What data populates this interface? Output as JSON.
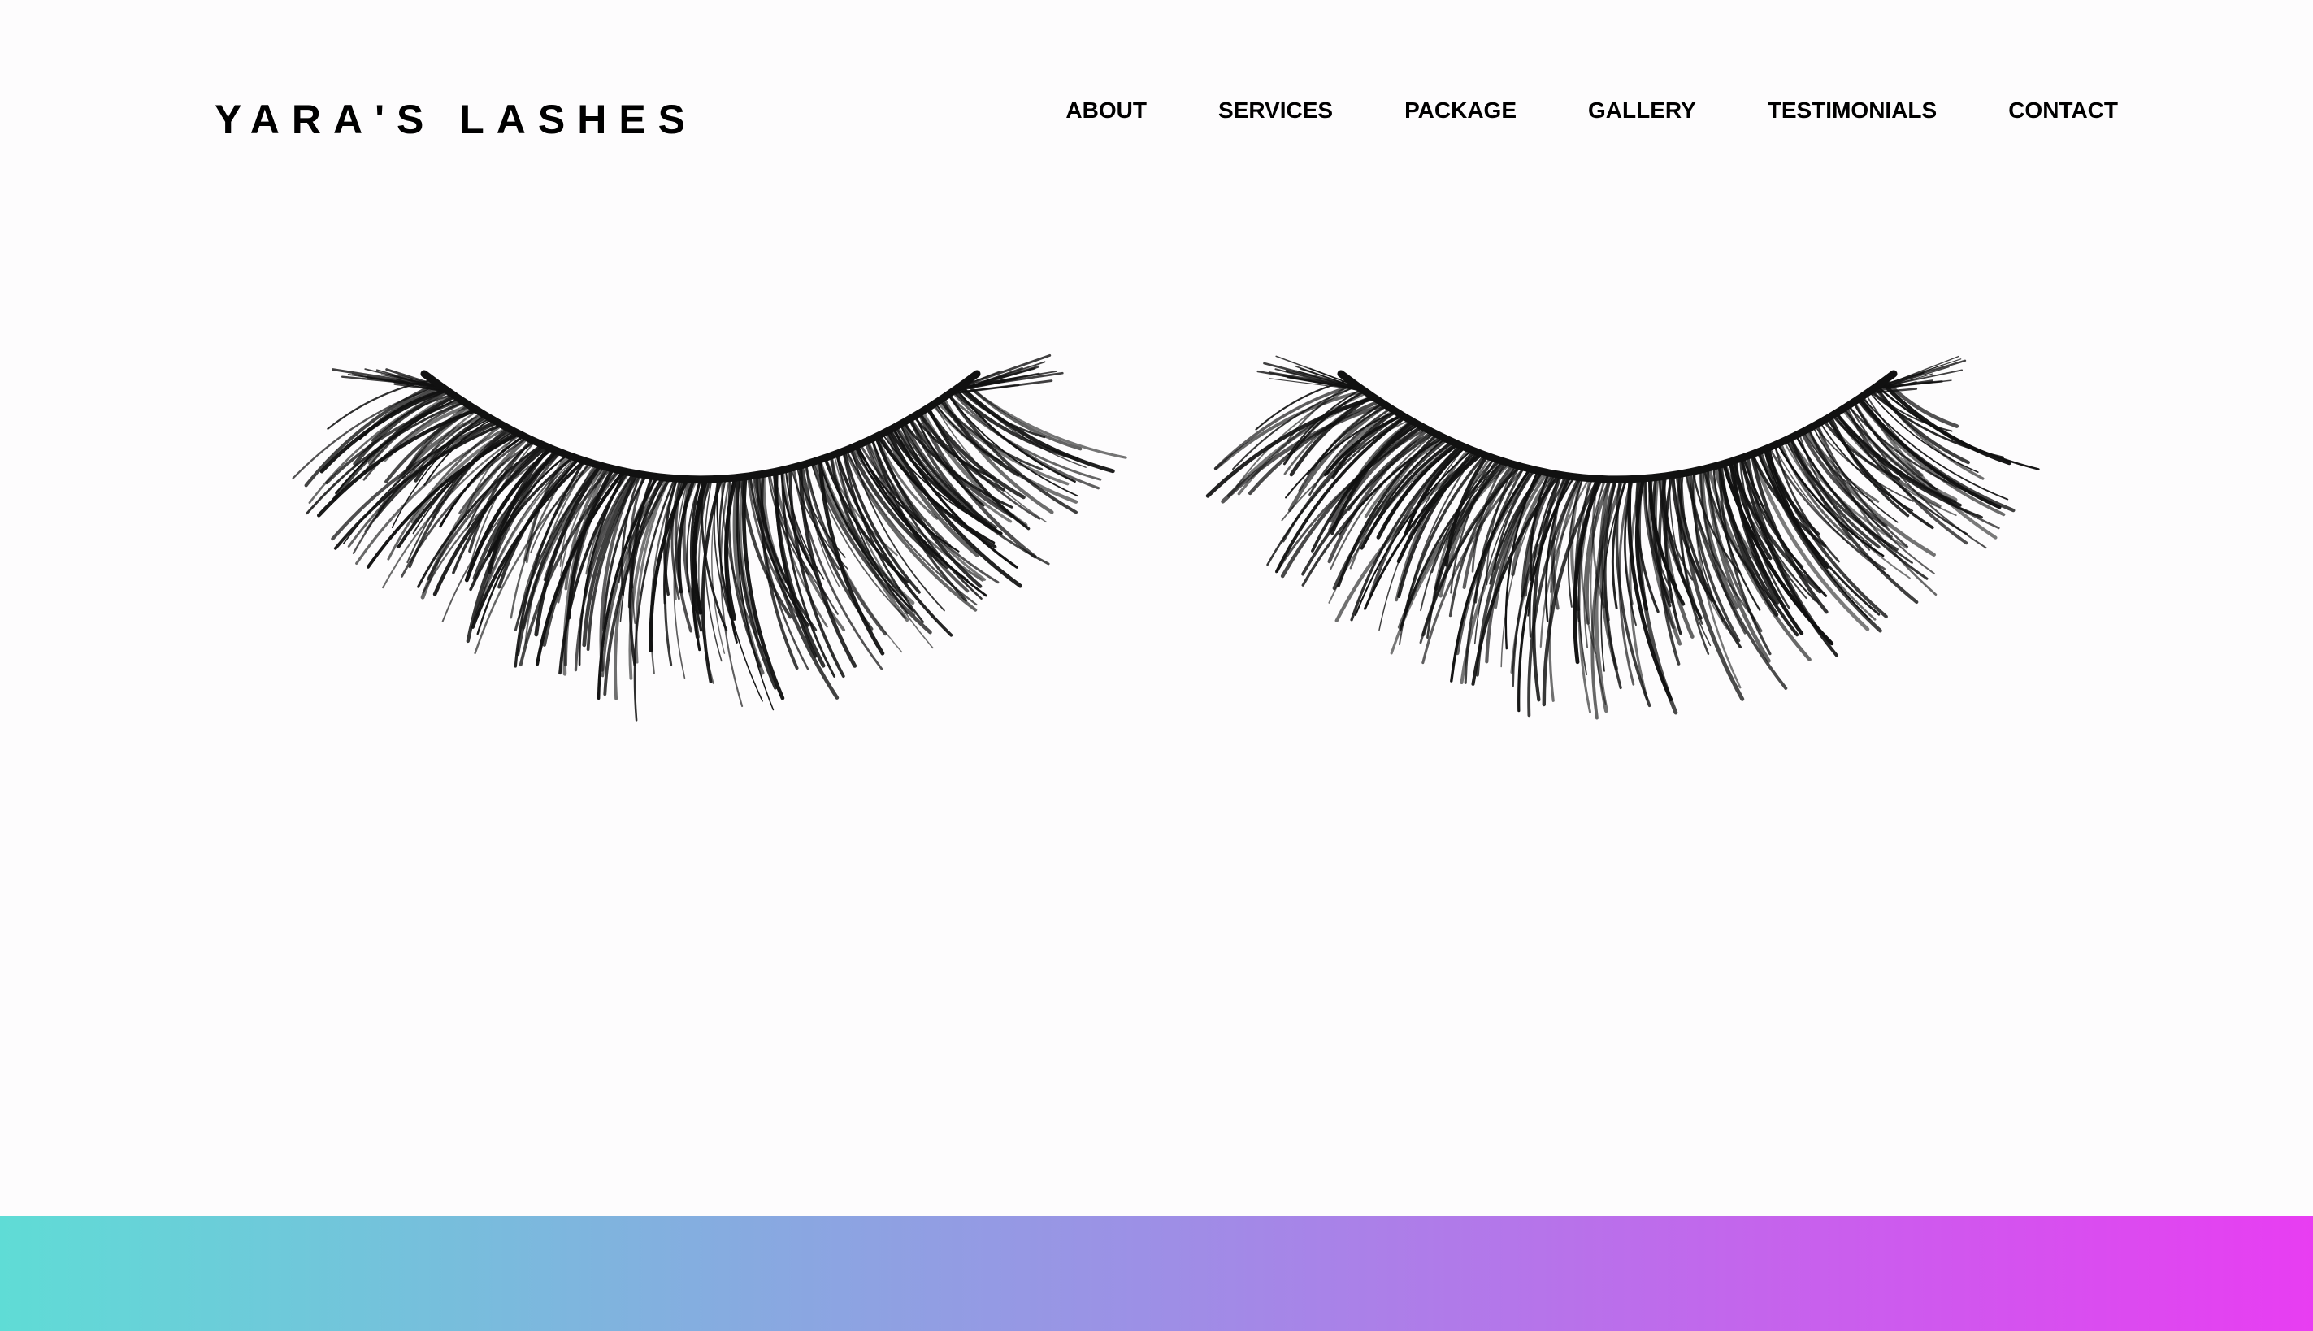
{
  "header": {
    "logo_text": "YARA'S LASHES",
    "nav": [
      {
        "label": "ABOUT"
      },
      {
        "label": "SERVICES"
      },
      {
        "label": "PACKAGE"
      },
      {
        "label": "GALLERY"
      },
      {
        "label": "TESTIMONIALS"
      },
      {
        "label": "CONTACT"
      }
    ]
  },
  "hero": {
    "image_subject": "pair-of-false-eyelashes",
    "lash_color": "#111111"
  },
  "footer_band": {
    "gradient_start": "#5fdcd6",
    "gradient_mid": "#9d8fe6",
    "gradient_end": "#e83df2"
  }
}
